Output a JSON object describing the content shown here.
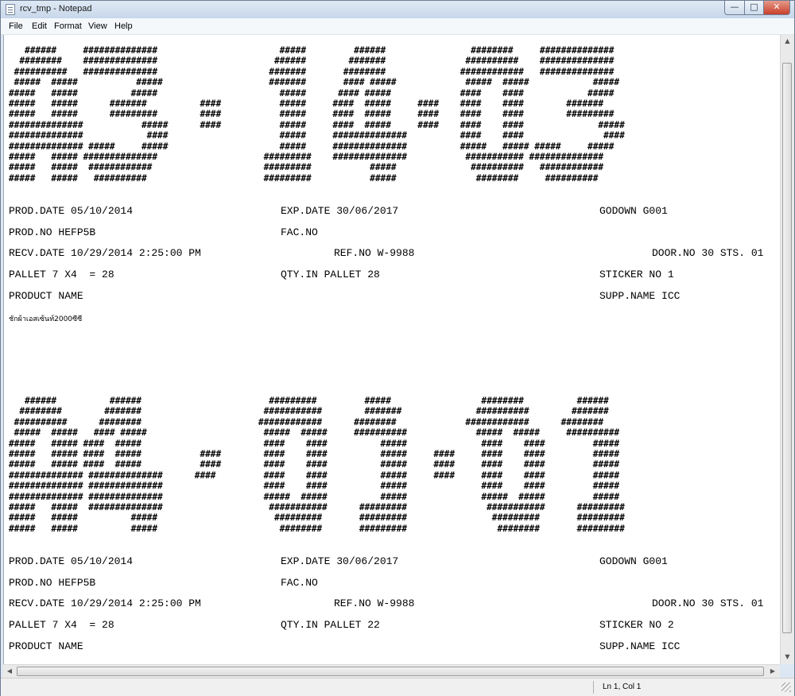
{
  "window": {
    "title": "rcv_tmp - Notepad"
  },
  "menu": [
    "File",
    "Edit",
    "Format",
    "View",
    "Help"
  ],
  "art": {
    "block1": [
      "   ######     ##############                       #####         ######                ########     ##############",
      "  ########    ##############                      ######        #######               ##########    ##############",
      " ##########   ##############                     #######       ########              ############   ##############",
      " #####  #####           #####                    #######       #### #####             #####  #####            #####",
      "#####   #####          #####                       #####      #### #####             ####    ####            #####",
      "#####   #####      #######          ####           #####     ####  #####     ####    ####    ####        #######",
      "#####   #####      #########        ####           #####     ####  #####     ####    ####    ####        #########",
      "##############           #####      ####           #####     ####  #####     ####    ####    ####              #####",
      "##############            ####                     #####     ##############          ####    ####               ####",
      "############## #####     #####                     #####     ##############          #####   ##### #####     #####",
      "#####   ##### ##############                    #########    ##############           ########### ##############",
      "#####   #####  ############                     #########           #####              ##########   ############",
      "#####   #####   ##########                      #########           #####               ########     ##########"
    ],
    "block2": [
      "   ######          ######                        #########         #####                 ########          ######",
      "  ########        #######                       ###########        #######              ##########        #######",
      " ##########      ########                      ############      ########             ############      ########",
      " #####  #####   #### #####                      #####  #####     ##########             #####  #####     ##########",
      "#####   ##### ####  #####                       ####    ####          #####              ####    ####         #####",
      "#####   ##### ####  #####           ####        ####    ####          #####     ####     ####    ####         #####",
      "#####   ##### ####  #####           ####        ####    ####          #####     ####     ####    ####         #####",
      "############## ##############      ####         ####    ####          #####     ####     ####    ####         #####",
      "############## ##############                   ####    ####          #####              ####    ####         #####",
      "############## ##############                   #####  #####          #####              #####  #####         #####",
      "#####   #####  ##############                    ###########      #########               ###########      #########",
      "#####   #####          #####                      #########       #########                #########       #########",
      "#####   #####          #####                       ########       #########                 ########       #########"
    ]
  },
  "records": [
    {
      "prod_date": "PROD.DATE 05/10/2014",
      "exp_date": "EXP.DATE 30/06/2017",
      "godown": "GODOWN G001",
      "prod_no": "PROD.NO HEFP5B",
      "fac_no": "FAC.NO",
      "recv_date": "RECV.DATE 10/29/2014 2:25:00 PM",
      "ref_no": "REF.NO W-9988",
      "door_no": "DOOR.NO 30 STS. 01",
      "pallet": "PALLET 7 X4  = 28",
      "qty_in_pallet": "QTY.IN PALLET 28",
      "sticker_no": "STICKER NO 1",
      "product_name": "PRODUCT NAME",
      "supp_name": "SUPP.NAME ICC",
      "product_value": "ชักผ้าเอสเซ้นท์2000ซีซี"
    },
    {
      "prod_date": "PROD.DATE 05/10/2014",
      "exp_date": "EXP.DATE 30/06/2017",
      "godown": "GODOWN G001",
      "prod_no": "PROD.NO HEFP5B",
      "fac_no": "FAC.NO",
      "recv_date": "RECV.DATE 10/29/2014 2:25:00 PM",
      "ref_no": "REF.NO W-9988",
      "door_no": "DOOR.NO 30 STS. 01",
      "pallet": "PALLET 7 X4  = 28",
      "qty_in_pallet": "QTY.IN PALLET 22",
      "sticker_no": "STICKER NO 2",
      "product_name": "PRODUCT NAME",
      "supp_name": "SUPP.NAME ICC"
    }
  ],
  "status": {
    "position": "Ln 1, Col 1"
  }
}
